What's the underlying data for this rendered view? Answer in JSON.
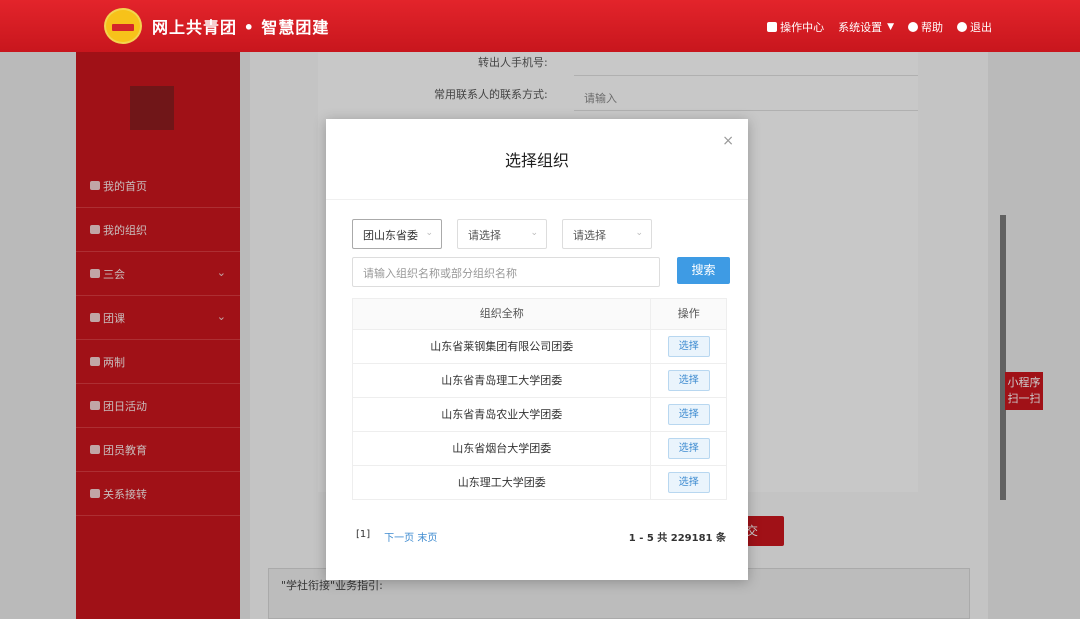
{
  "header": {
    "brand": "网上共青团 • 智慧团建",
    "nav": [
      {
        "label": "操作中心"
      },
      {
        "label": "系统设置"
      },
      {
        "label": "帮助"
      },
      {
        "label": "退出"
      }
    ]
  },
  "sidebar": {
    "items": [
      {
        "label": "我的首页"
      },
      {
        "label": "我的组织"
      },
      {
        "label": "三会"
      },
      {
        "label": "团课"
      },
      {
        "label": "两制"
      },
      {
        "label": "团日活动"
      },
      {
        "label": "团员教育"
      },
      {
        "label": "关系接转"
      }
    ]
  },
  "background_form": {
    "label_phone": "转出人手机号:",
    "label_contact": "常用联系人的联系方式:",
    "contact_placeholder": "请输入",
    "submit_label": "交",
    "guide_text": "\"学社衔接\"业务指引:"
  },
  "mini_app": "小程序扫一扫",
  "modal": {
    "title": "选择组织",
    "close": "×",
    "selects": [
      "团山东省委",
      "请选择",
      "请选择"
    ],
    "search_placeholder": "请输入组织名称或部分组织名称",
    "search_button": "搜索",
    "columns": [
      "组织全称",
      "操作"
    ],
    "rows": [
      {
        "name": "山东省莱钢集团有限公司团委",
        "action": "选择"
      },
      {
        "name": "山东省青岛理工大学团委",
        "action": "选择"
      },
      {
        "name": "山东省青岛农业大学团委",
        "action": "选择"
      },
      {
        "name": "山东省烟台大学团委",
        "action": "选择"
      },
      {
        "name": "山东理工大学团委",
        "action": "选择"
      }
    ],
    "pager": {
      "current": "[1]",
      "next": "下一页",
      "last": "末页",
      "total": "1 - 5  共 229181 条"
    }
  }
}
